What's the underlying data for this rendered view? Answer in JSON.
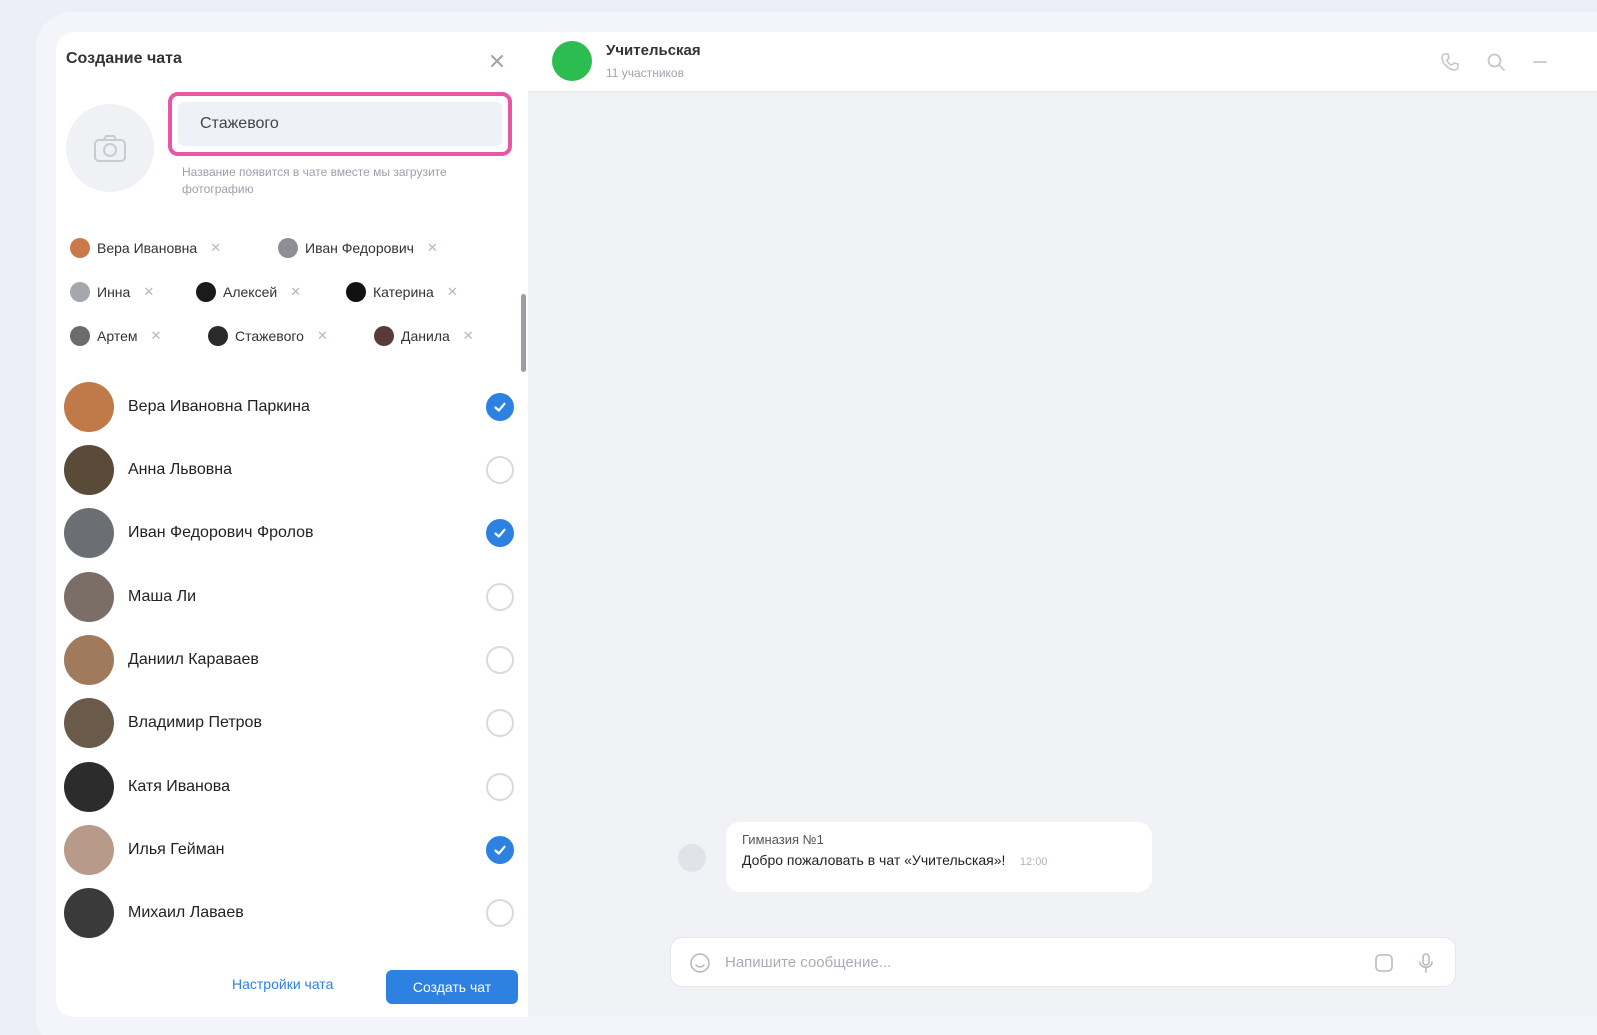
{
  "panel": {
    "title": "Создание чата",
    "name_value": "Стажевого",
    "name_hint": "Название появится в чате вместе мы загрузите фотографию"
  },
  "chips": [
    {
      "label": "Вера Ивановна",
      "color": "#c9794a"
    },
    {
      "label": "Иван Федорович",
      "color": "#8d8f94"
    },
    {
      "label": "Инна",
      "color": "#a4a7ad"
    },
    {
      "label": "Алексей",
      "color": "#1b1b1b"
    },
    {
      "label": "Катерина",
      "color": "#111111"
    },
    {
      "label": "Артем",
      "color": "#6d6b70"
    },
    {
      "label": "Стажевого",
      "color": "#2a2a2a"
    },
    {
      "label": "Данила",
      "color": "#5b3a3a"
    }
  ],
  "contacts": [
    {
      "name": "Вера Ивановна Паркина",
      "checked": true,
      "color": "#c07a4a"
    },
    {
      "name": "Анна Львовна",
      "checked": false,
      "color": "#5a4a38"
    },
    {
      "name": "Иван Федорович Фролов",
      "checked": true,
      "color": "#6b6e72"
    },
    {
      "name": "Маша Ли",
      "checked": false,
      "color": "#7a6e66"
    },
    {
      "name": "Даниил Караваев",
      "checked": false,
      "color": "#a07a5c"
    },
    {
      "name": "Владимир Петров",
      "checked": false,
      "color": "#6a5a4a"
    },
    {
      "name": "Катя Иванова",
      "checked": false,
      "color": "#2c2c2c"
    },
    {
      "name": "Илья Гейман",
      "checked": true,
      "color": "#b89a8a"
    },
    {
      "name": "Михаил Лаваев",
      "checked": false,
      "color": "#3a3a3a"
    }
  ],
  "footer": {
    "settings_label": "Настройки чата",
    "create_label": "Создать чат"
  },
  "chat": {
    "title": "Учительская",
    "subtitle": "11 участников",
    "message_sender": "Гимназия №1",
    "message_text": "Добро пожаловать в чат «Учительская»!",
    "message_time": "12:00",
    "input_placeholder": "Напишите сообщение...",
    "accent_color": "#2bbd4f"
  },
  "colors": {
    "primary": "#2d81e0",
    "highlight": "#e957a4"
  }
}
